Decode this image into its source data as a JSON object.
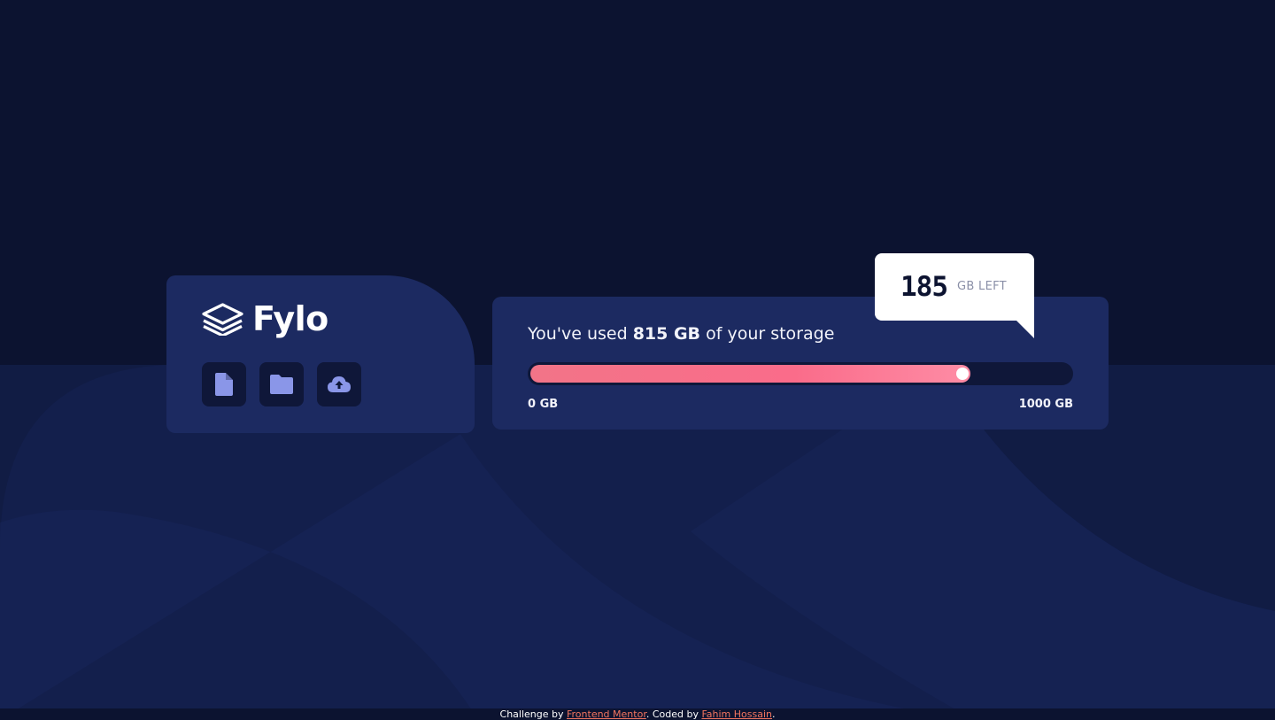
{
  "brand": {
    "name": "Fylo",
    "logo_icon": "stacked-layers-icon"
  },
  "toolbar": {
    "buttons": [
      {
        "icon": "document-icon"
      },
      {
        "icon": "folder-icon"
      },
      {
        "icon": "upload-cloud-icon"
      }
    ]
  },
  "storage": {
    "used_prefix": "You've used",
    "used_amount": "815 GB",
    "used_suffix": "of your storage",
    "used_fraction": 0.815,
    "scale_min": "0 GB",
    "scale_max": "1000 GB",
    "left_amount": "185",
    "left_label": "GB LEFT"
  },
  "footer": {
    "prefix": "Challenge by",
    "link1": "Frontend Mentor",
    "middle": ". Coded by",
    "link2": "Fahim Hossain",
    "suffix": "."
  },
  "colors": {
    "background": "#0c1330",
    "card": "#1c2a61",
    "icon_button": "#0f1739",
    "icon": "#8a96e8",
    "bar_gradient_start": "#f27488",
    "bar_gradient_end": "#fe8ca5",
    "link": "#f2755f"
  }
}
